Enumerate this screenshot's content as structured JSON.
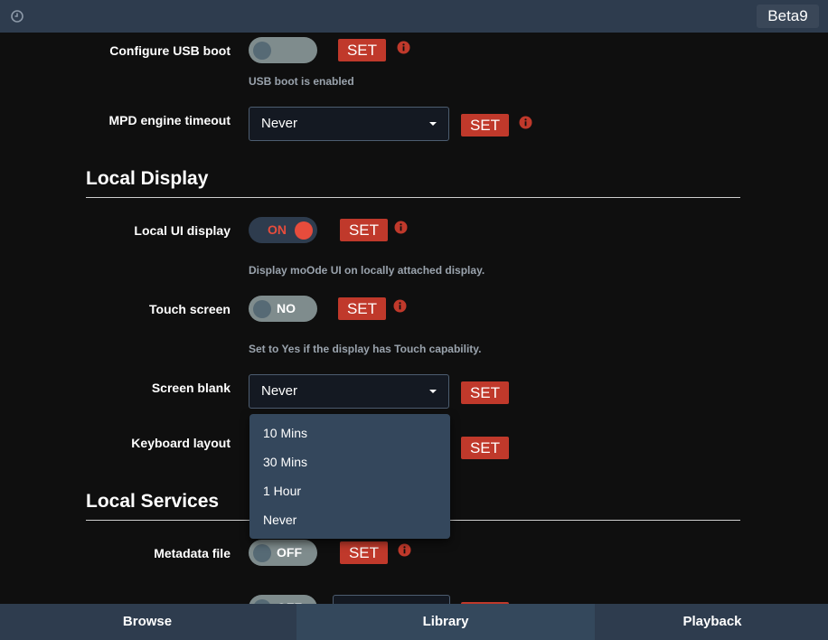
{
  "header": {
    "version": "Beta9"
  },
  "usb_boot": {
    "label": "Configure USB boot",
    "toggle": "",
    "set": "SET",
    "help": "USB boot is enabled"
  },
  "mpd_timeout": {
    "label": "MPD engine timeout",
    "value": "Never",
    "set": "SET"
  },
  "local_display": {
    "title": "Local Display",
    "ui_display": {
      "label": "Local UI display",
      "toggle": "ON",
      "set": "SET",
      "help": "Display moOde UI on locally attached display."
    },
    "touch_screen": {
      "label": "Touch screen",
      "toggle": "NO",
      "set": "SET",
      "help": "Set to Yes if the display has Touch capability."
    },
    "screen_blank": {
      "label": "Screen blank",
      "value": "Never",
      "set": "SET",
      "options": [
        "10 Mins",
        "30 Mins",
        "1 Hour",
        "Never"
      ]
    },
    "keyboard_layout": {
      "label": "Keyboard layout",
      "set": "SET"
    }
  },
  "local_services": {
    "title": "Local Services",
    "metadata_file": {
      "label": "Metadata file",
      "toggle": "OFF",
      "set": "SET"
    },
    "next_row": {
      "toggle": "OFF"
    }
  },
  "nav": {
    "tabs": [
      "Browse",
      "Library",
      "Playback"
    ]
  },
  "colors": {
    "accent": "#c0392b",
    "toggle_on": "#e74c3c",
    "bar": "#2e3c4e"
  }
}
